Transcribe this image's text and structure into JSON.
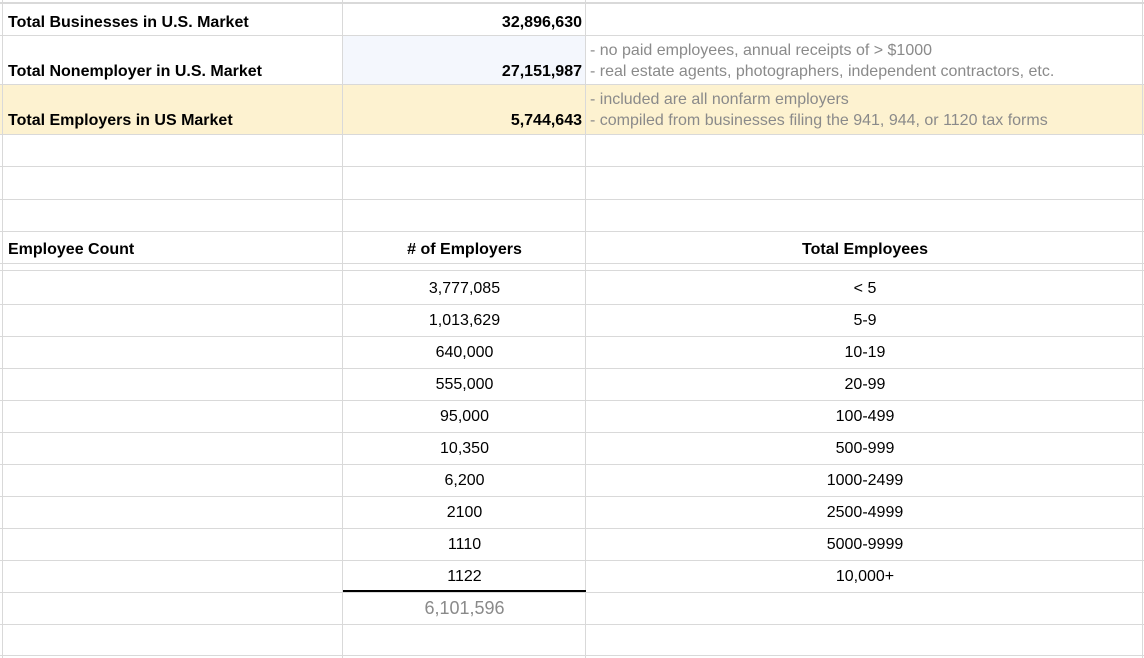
{
  "summary": {
    "total_businesses": {
      "label": "Total Businesses in U.S. Market",
      "value": "32,896,630"
    },
    "total_nonemployer": {
      "label": "Total Nonemployer in U.S. Market",
      "value": "27,151,987",
      "notes": [
        "- no paid employees, annual receipts of > $1000",
        "- real estate agents, photographers, independent contractors, etc."
      ]
    },
    "total_employers": {
      "label": "Total Employers in US Market",
      "value": "5,744,643",
      "notes": [
        "- included are all nonfarm employers",
        "- compiled from businesses filing the 941, 944, or 1120 tax forms"
      ]
    }
  },
  "table": {
    "headers": [
      "Employee Count",
      "# of Employers",
      "Total Employees"
    ],
    "rows": [
      {
        "employers": "3,777,085",
        "employees": "< 5"
      },
      {
        "employers": "1,013,629",
        "employees": "5-9"
      },
      {
        "employers": "640,000",
        "employees": "10-19"
      },
      {
        "employers": "555,000",
        "employees": "20-99"
      },
      {
        "employers": "95,000",
        "employees": "100-499"
      },
      {
        "employers": "10,350",
        "employees": "500-999"
      },
      {
        "employers": "6,200",
        "employees": "1000-2499"
      },
      {
        "employers": "2100",
        "employees": "2500-4999"
      },
      {
        "employers": "1110",
        "employees": "5000-9999"
      },
      {
        "employers": "1122",
        "employees": "10,000+"
      }
    ],
    "total": "6,101,596"
  },
  "colors": {
    "highlight_row": "#fdf2d0",
    "light_blue_cell": "#f4f7fd",
    "grid": "#d9d9d9",
    "muted_text": "#8a8a8a"
  }
}
